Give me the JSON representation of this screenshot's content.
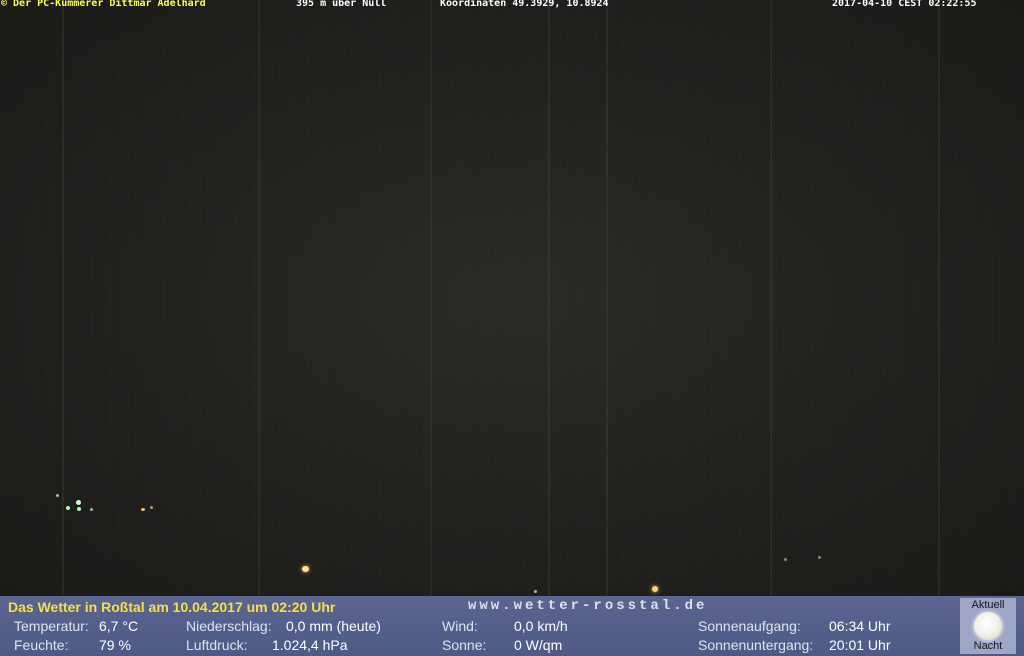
{
  "overlay": {
    "owner": "© Der PC-Kümmerer Dittmar Adelhard",
    "altitude": "395 m über Null",
    "coordinates": "Koordinaten 49.3929, 10.8924",
    "datetime": "2017-04-10 CEST 02:22:55"
  },
  "weather": {
    "headline": "Das Wetter in Roßtal am 10.04.2017 um 02:20 Uhr",
    "website": "www.wetter-rosstal.de",
    "temperature": {
      "label": "Temperatur:",
      "value": "6,7 °C"
    },
    "humidity": {
      "label": "Feuchte:",
      "value": "79 %"
    },
    "precipitation": {
      "label": "Niederschlag:",
      "value": "0,0 mm (heute)"
    },
    "pressure": {
      "label": "Luftdruck:",
      "value": "1.024,4 hPa"
    },
    "wind": {
      "label": "Wind:",
      "value": "0,0 km/h"
    },
    "sun": {
      "label": "Sonne:",
      "value": "0 W/qm"
    },
    "sunrise": {
      "label": "Sonnenaufgang:",
      "value": "06:34 Uhr"
    },
    "sunset": {
      "label": "Sonnenuntergang:",
      "value": "20:01 Uhr"
    },
    "moon": {
      "top_label": "Aktuell",
      "bottom_label": "Nacht",
      "icon": "full-moon-icon"
    }
  },
  "colors": {
    "overlay_owner": "#ffff55",
    "headline": "#f3e04a",
    "weather_bar": "#56628c"
  }
}
